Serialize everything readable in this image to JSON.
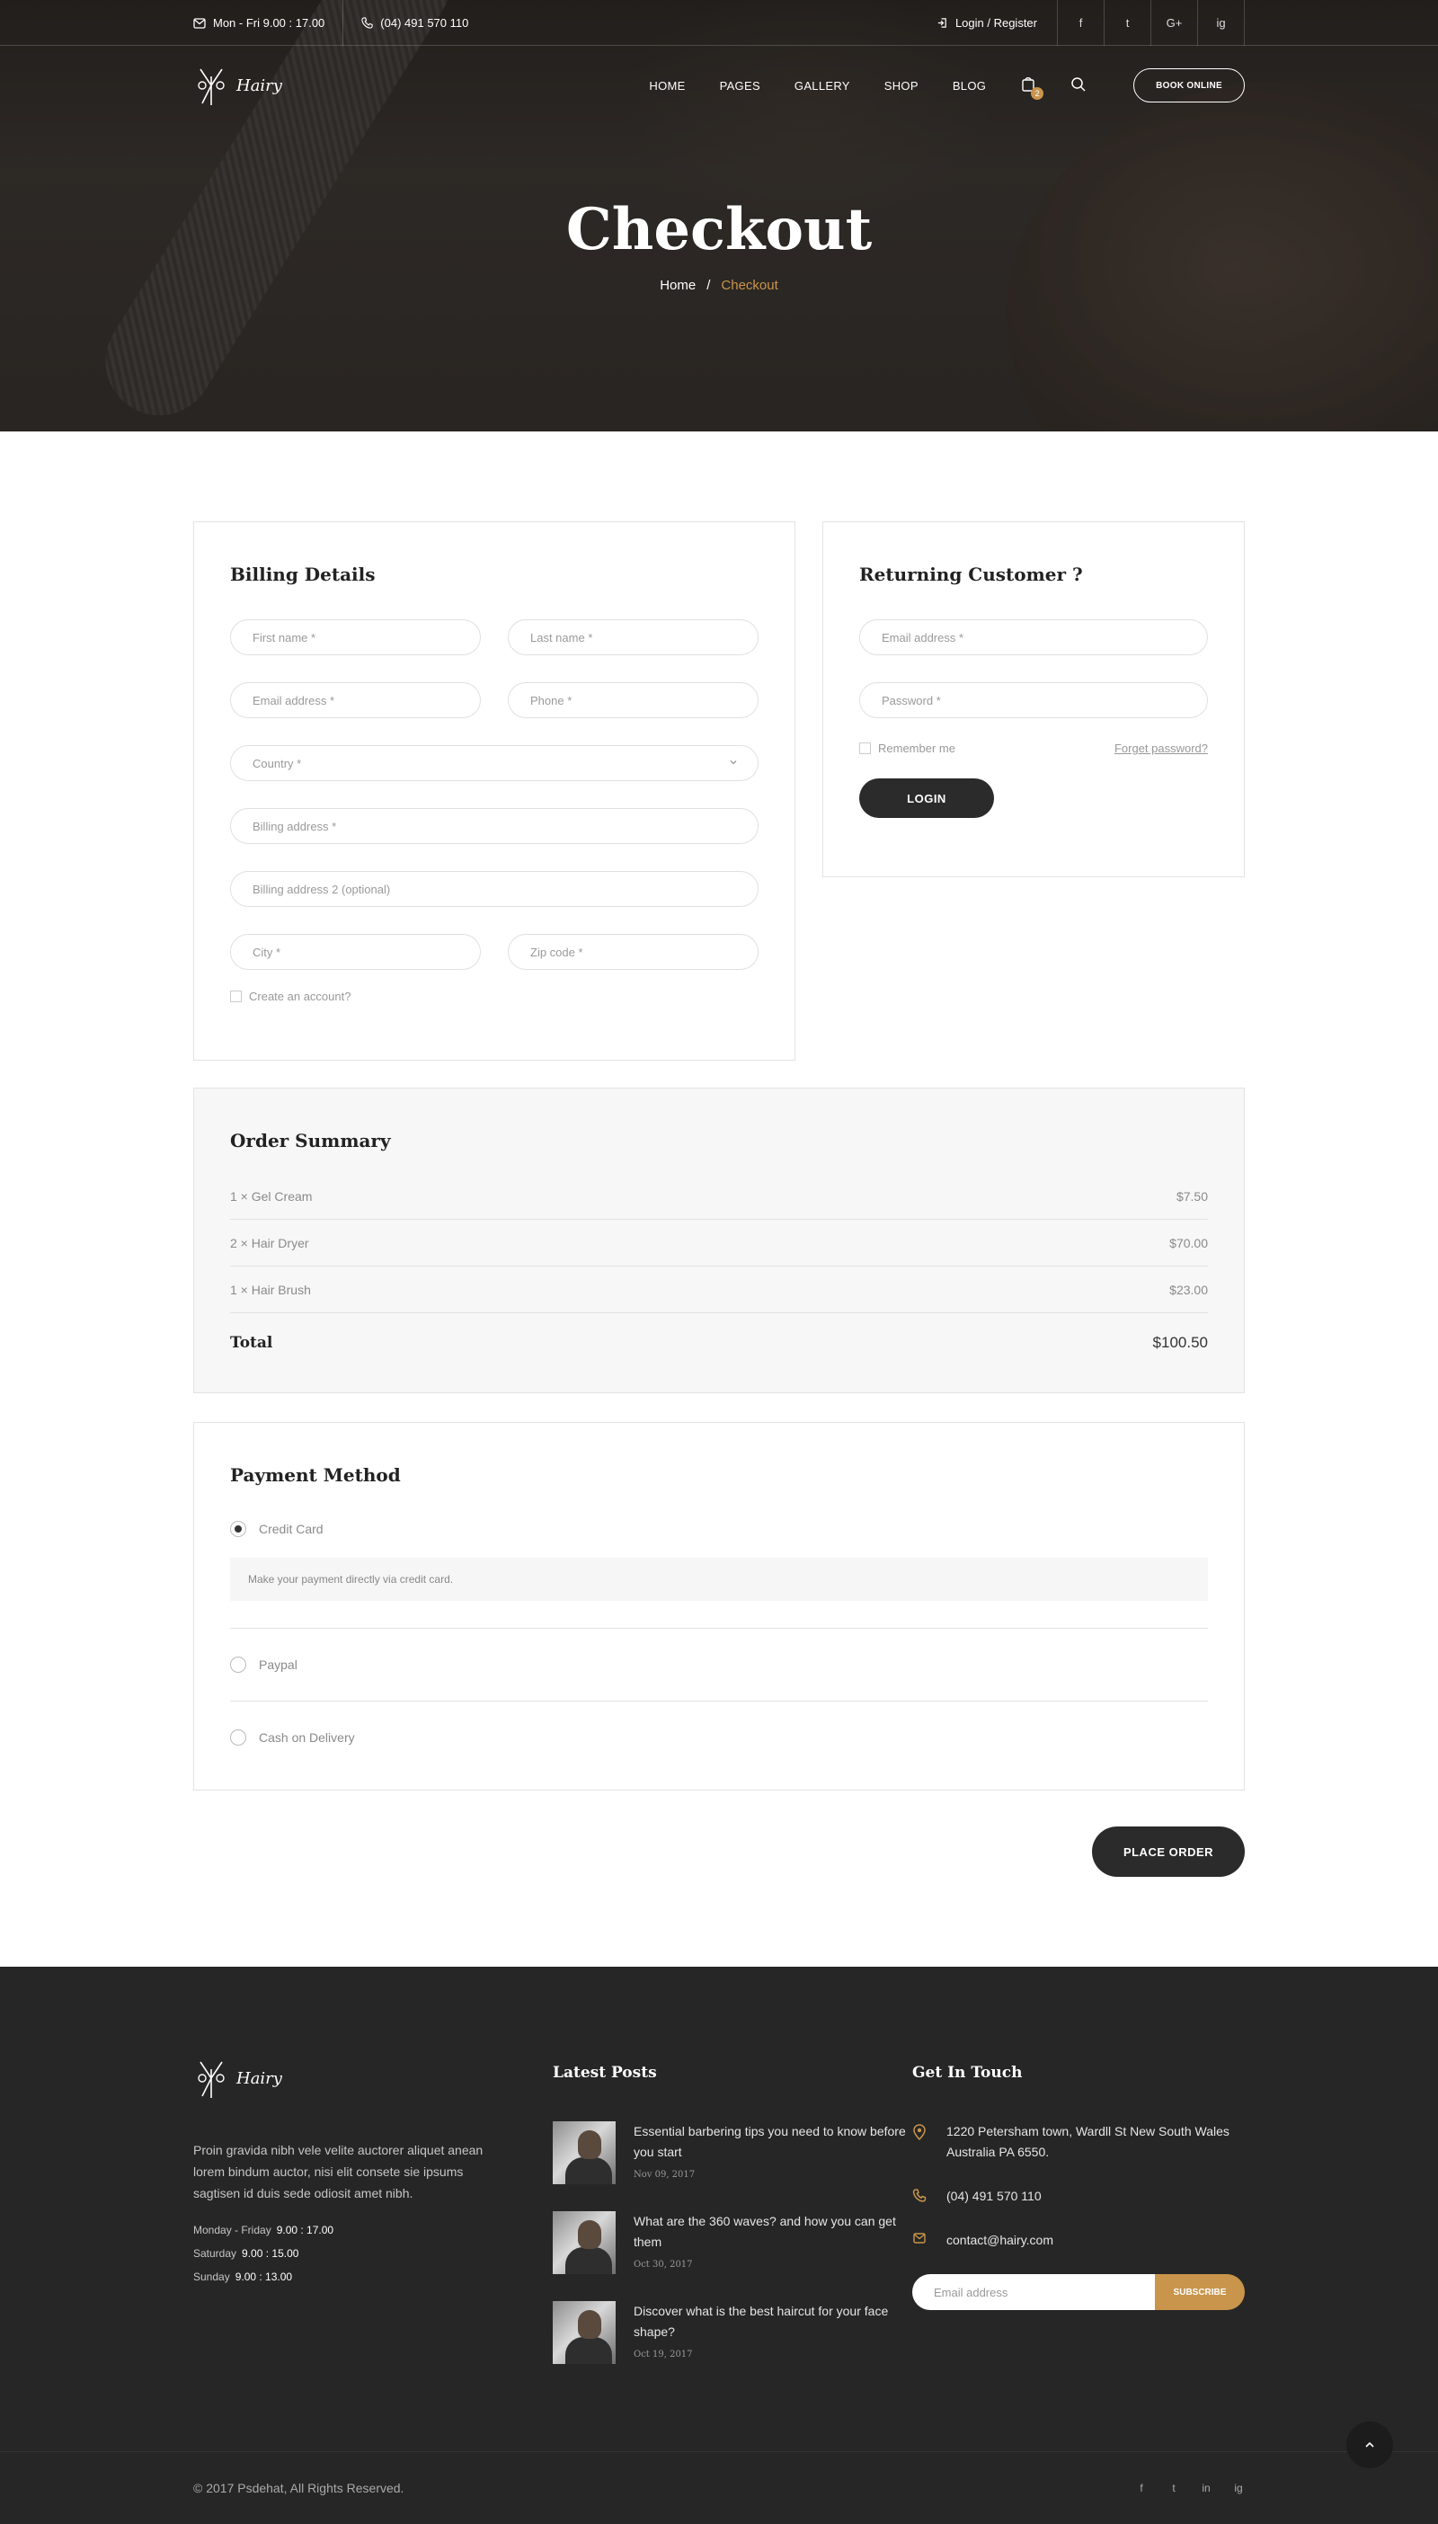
{
  "topbar": {
    "hours": "Mon - Fri  9.00 : 17.00",
    "phone": "(04) 491 570 110",
    "login": "Login / Register",
    "social": [
      "f",
      "t",
      "G+",
      "ig"
    ]
  },
  "nav": {
    "logo": "Hairy",
    "items": [
      "HOME",
      "PAGES",
      "GALLERY",
      "SHOP",
      "BLOG"
    ],
    "cart_count": "2",
    "book": "BOOK ONLINE"
  },
  "hero": {
    "title": "Checkout",
    "crumb_home": "Home",
    "crumb_sep": "/",
    "crumb_current": "Checkout"
  },
  "billing": {
    "title": "Billing Details",
    "first_name": "First name *",
    "last_name": "Last name *",
    "email": "Email address *",
    "phone": "Phone *",
    "country": "Country *",
    "address": "Billing address *",
    "address2": "Billing address 2 (optional)",
    "city": "City *",
    "zip": "Zip code *",
    "create_account": "Create an account?"
  },
  "returning": {
    "title": "Returning Customer ?",
    "email": "Email address *",
    "password": "Password *",
    "remember": "Remember me",
    "forgot": "Forget password?",
    "login": "LOGIN"
  },
  "summary": {
    "title": "Order Summary",
    "items": [
      {
        "name": "1 × Gel Cream",
        "price": "$7.50"
      },
      {
        "name": "2 × Hair Dryer",
        "price": "$70.00"
      },
      {
        "name": "1 × Hair Brush",
        "price": "$23.00"
      }
    ],
    "total_label": "Total",
    "total_value": "$100.50"
  },
  "payment": {
    "title": "Payment Method",
    "credit": "Credit Card",
    "credit_desc": "Make your payment directly via credit card.",
    "paypal": "Paypal",
    "cod": "Cash on Delivery",
    "place_order": "PLACE ORDER"
  },
  "footer": {
    "logo": "Hairy",
    "about": "Proin gravida nibh vele velite auctorer aliquet anean lorem bindum auctor, nisi elit consete sie ipsums sagtisen id duis sede odiosit amet nibh.",
    "hours": [
      {
        "day": "Monday - Friday",
        "time": "9.00 : 17.00"
      },
      {
        "day": "Saturday",
        "time": "9.00 : 15.00"
      },
      {
        "day": "Sunday",
        "time": "9.00 : 13.00"
      }
    ],
    "posts_title": "Latest Posts",
    "posts": [
      {
        "title": "Essential barbering tips you need to know before you start",
        "date": "Nov 09, 2017"
      },
      {
        "title": "What are the 360 waves? and how you can get them",
        "date": "Oct 30, 2017"
      },
      {
        "title": "Discover what is the best haircut for your face shape?",
        "date": "Oct 19, 2017"
      }
    ],
    "contact_title": "Get In Touch",
    "address": "1220 Petersham town, Wardll St New South Wales Australia PA 6550.",
    "phone": "(04) 491 570 110",
    "email": "contact@hairy.com",
    "subscribe_placeholder": "Email address",
    "subscribe_btn": "SUBSCRIBE",
    "copyright": "© 2017 Psdehat, All Rights Reserved.",
    "social": [
      "f",
      "t",
      "in",
      "ig"
    ]
  },
  "colors": {
    "accent": "#c9954c",
    "dark": "#2b2b2b",
    "footer": "#262626"
  }
}
